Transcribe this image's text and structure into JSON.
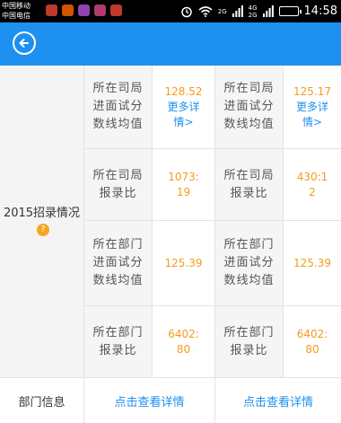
{
  "status_bar": {
    "carrier_1": "中国移动",
    "carrier_2": "中国电信",
    "network_1": "2G",
    "network_2": "4G",
    "network_3": "2G",
    "time": "14:58",
    "icons": [
      "alarm-icon",
      "wifi-icon",
      "signal-icon",
      "signal-icon",
      "battery-icon"
    ]
  },
  "app_bar": {
    "back_icon": "back-arrow-icon",
    "accent": "#1e90f0"
  },
  "section_2015": {
    "title": "2015招录情况",
    "help_badge": "?",
    "rows": [
      {
        "left": {
          "label": "所在司局进面试分数线均值",
          "value": "128.52",
          "link": "更多详情>"
        },
        "right": {
          "label": "所在司局进面试分数线均值",
          "value": "125.17",
          "link": "更多详情>"
        }
      },
      {
        "left": {
          "label": "所在司局报录比",
          "value": "1073:19"
        },
        "right": {
          "label": "所在司局报录比",
          "value": "430:12"
        }
      },
      {
        "left": {
          "label": "所在部门进面试分数线均值",
          "value": "125.39"
        },
        "right": {
          "label": "所在部门进面试分数线均值",
          "value": "125.39"
        }
      },
      {
        "left": {
          "label": "所在部门报录比",
          "value": "6402:80"
        },
        "right": {
          "label": "所在部门报录比",
          "value": "6402:80"
        }
      }
    ]
  },
  "department_info": {
    "label": "部门信息",
    "left_link": "点击查看详情",
    "right_link": "点击查看详情"
  },
  "colors": {
    "value": "#f29c1f",
    "link": "#1e90f0",
    "badge": "#f5a623"
  }
}
